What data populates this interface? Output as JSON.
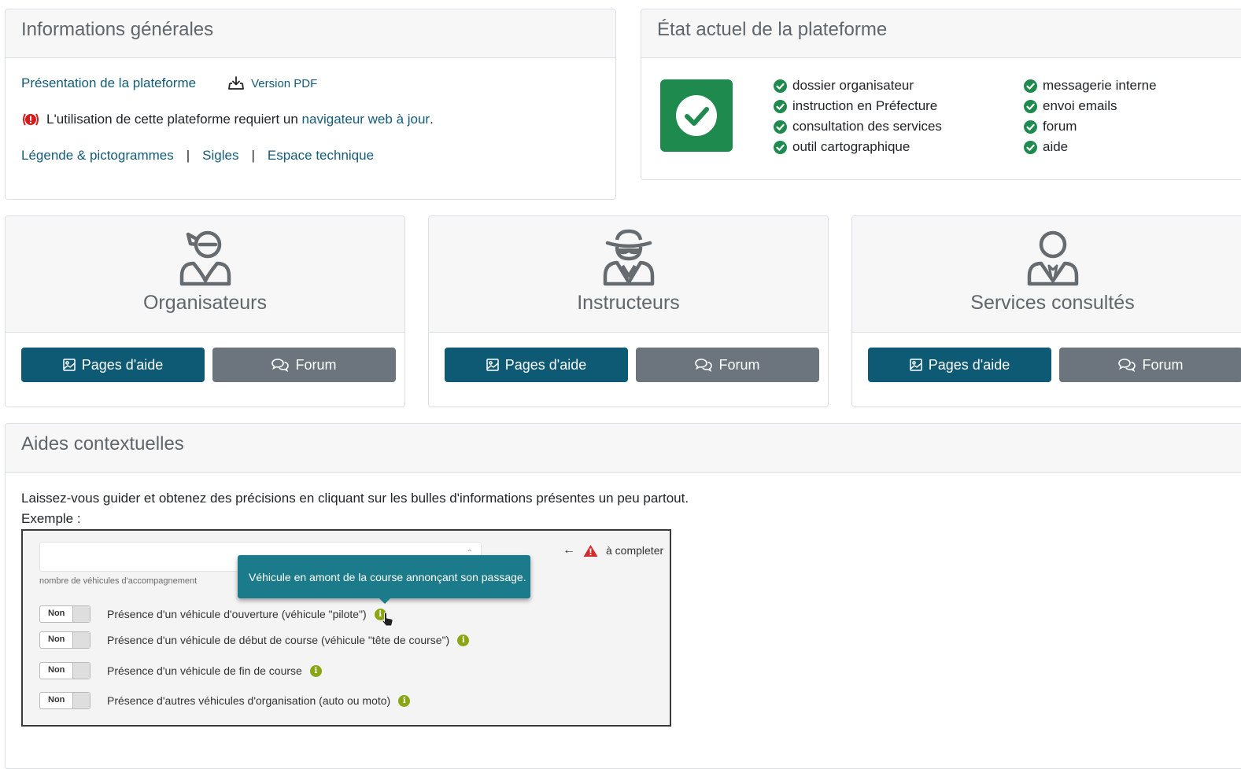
{
  "info": {
    "title": "Informations générales",
    "presentation_link": "Présentation de la plateforme",
    "pdf_link": "Version PDF",
    "browser_text_before": "L'utilisation de cette plateforme requiert un ",
    "browser_link": "navigateur web à jour",
    "browser_text_after": ".",
    "links": [
      "Légende & pictogrammes",
      "Sigles",
      "Espace technique"
    ],
    "separator": "|"
  },
  "etat": {
    "title": "État actuel de la plateforme",
    "status_color": "#1e8a4d",
    "col1": [
      "dossier organisateur",
      "instruction en Préfecture",
      "consultation des services",
      "outil cartographique"
    ],
    "col2": [
      "messagerie interne",
      "envoi emails",
      "forum",
      "aide"
    ]
  },
  "roles": [
    {
      "title": "Organisateurs",
      "icon": "bandana-user-icon",
      "help_label": "Pages d'aide",
      "forum_label": "Forum"
    },
    {
      "title": "Instructeurs",
      "icon": "detective-user-icon",
      "help_label": "Pages d'aide",
      "forum_label": "Forum"
    },
    {
      "title": "Services consultés",
      "icon": "tie-user-icon",
      "help_label": "Pages d'aide",
      "forum_label": "Forum"
    }
  ],
  "aides": {
    "title": "Aides contextuelles",
    "intro": "Laissez-vous guider et obtenez des précisions en cliquant sur les bulles d'informations présentes un peu partout.",
    "example_label": "Exemple :",
    "example": {
      "input_caption": "nombre de véhicules d'accompagnement",
      "legend_arrow": "←",
      "legend_text": "à completer",
      "tooltip": "Véhicule en amont de la course annonçant son passage.",
      "toggles": [
        {
          "state": "Non",
          "label": "Présence d'un véhicule d'ouverture (véhicule \"pilote\")"
        },
        {
          "state": "Non",
          "label": "Présence d'un véhicule de début de course (véhicule \"tête de course\")"
        },
        {
          "state": "Non",
          "label": "Présence d'un véhicule de fin de course"
        },
        {
          "state": "Non",
          "label": "Présence d'autres véhicules d'organisation (auto ou moto)"
        }
      ]
    }
  }
}
